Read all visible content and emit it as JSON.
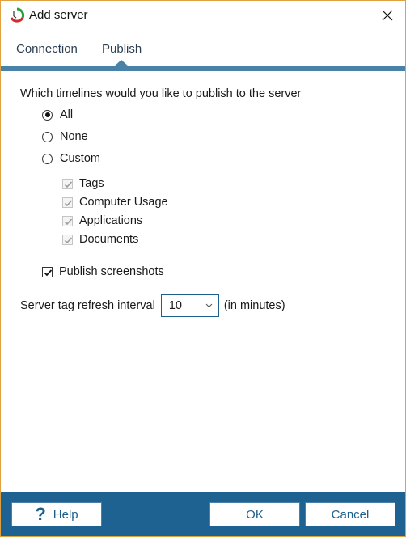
{
  "window": {
    "title": "Add server",
    "app_icon": "timer-clock-icon",
    "close_icon": "close-icon"
  },
  "tabs": [
    {
      "label": "Connection",
      "active": false
    },
    {
      "label": "Publish",
      "active": true
    }
  ],
  "publish": {
    "question": "Which timelines would you like to publish to the server",
    "radio_options": [
      {
        "label": "All",
        "checked": true
      },
      {
        "label": "None",
        "checked": false
      },
      {
        "label": "Custom",
        "checked": false
      }
    ],
    "custom_timelines": [
      {
        "label": "Tags",
        "checked": true,
        "disabled": true
      },
      {
        "label": "Computer Usage",
        "checked": true,
        "disabled": true
      },
      {
        "label": "Applications",
        "checked": true,
        "disabled": true
      },
      {
        "label": "Documents",
        "checked": true,
        "disabled": true
      }
    ],
    "screenshots": {
      "label": "Publish screenshots",
      "checked": true
    },
    "interval": {
      "label": "Server tag refresh interval",
      "value": "10",
      "suffix": "(in minutes)"
    }
  },
  "footer": {
    "help_label": "Help",
    "help_icon": "question-mark-icon",
    "ok_label": "OK",
    "cancel_label": "Cancel"
  },
  "colors": {
    "accent": "#4882a8",
    "footer_bg": "#1d6290",
    "window_border": "#e0a040"
  }
}
